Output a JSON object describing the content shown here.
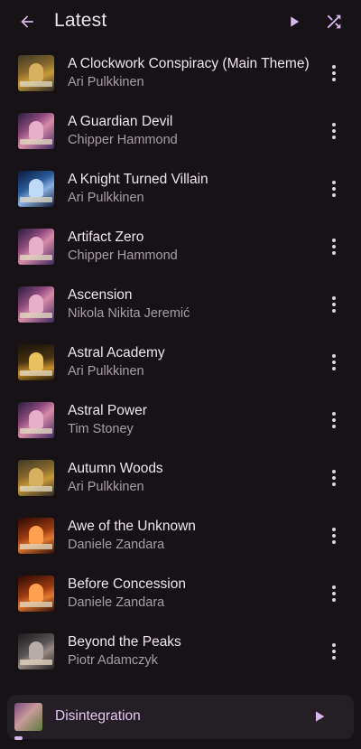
{
  "header": {
    "title": "Latest",
    "back_icon": "arrow-back-icon",
    "play_icon": "play-icon",
    "shuffle_icon": "shuffle-icon",
    "icon_color": "#d8b8ec"
  },
  "songs": [
    {
      "title": "A Clockwork Conspiracy (Main Theme)",
      "artist": "Ari Pulkkinen",
      "art": "trine5"
    },
    {
      "title": "A Guardian Devil",
      "artist": "Chipper Hammond",
      "art": "purple"
    },
    {
      "title": "A Knight Turned Villain",
      "artist": "Ari Pulkkinen",
      "art": "blue"
    },
    {
      "title": "Artifact Zero",
      "artist": "Chipper Hammond",
      "art": "purple"
    },
    {
      "title": "Ascension",
      "artist": "Nikola Nikita Jeremić",
      "art": "purple"
    },
    {
      "title": "Astral Academy",
      "artist": "Ari Pulkkinen",
      "art": "trine-gold"
    },
    {
      "title": "Astral Power",
      "artist": "Tim Stoney",
      "art": "purple"
    },
    {
      "title": "Autumn Woods",
      "artist": "Ari Pulkkinen",
      "art": "trine5"
    },
    {
      "title": "Awe of the Unknown",
      "artist": "Daniele Zandara",
      "art": "orange"
    },
    {
      "title": "Before Concession",
      "artist": "Daniele Zandara",
      "art": "orange"
    },
    {
      "title": "Beyond the Peaks",
      "artist": "Piotr Adamczyk",
      "art": "grey"
    }
  ],
  "now_playing": {
    "title": "Disintegration",
    "progress": 0.02
  },
  "colors": {
    "background": "#161216",
    "accent": "#d8b8ec",
    "secondary_text": "#a79ea8"
  }
}
